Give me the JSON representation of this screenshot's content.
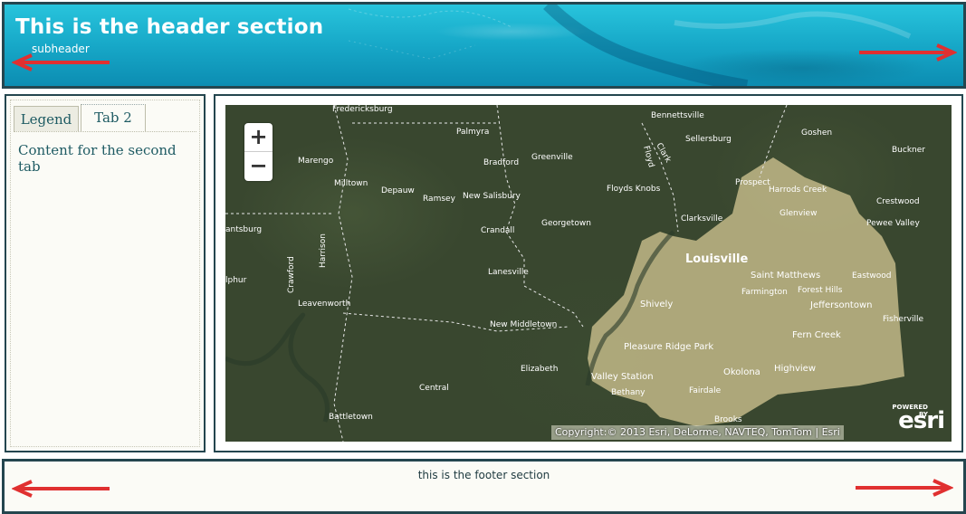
{
  "header": {
    "title": "This is the header section",
    "subtitle": "subheader"
  },
  "tabs": [
    {
      "label": "Legend",
      "active": false
    },
    {
      "label": "Tab 2",
      "active": true
    }
  ],
  "tab_content": "Content for the second tab",
  "map": {
    "zoom_in_label": "+",
    "zoom_out_label": "−",
    "attribution": "Copyright:© 2013 Esri, DeLorme, NAVTEQ, TomTom | Esri",
    "logo_powered": "POWERED BY",
    "logo_word": "esri",
    "places": [
      "Fredericksburg",
      "Palmyra",
      "Bennettsville",
      "Sellersburg",
      "Goshen",
      "Buckner",
      "Marengo",
      "Bradford",
      "Greenville",
      "Clark",
      "Floyd",
      "Prospect",
      "Harrods Creek",
      "Glenview",
      "Crestwood",
      "Pewee Valley",
      "Milltown",
      "Depauw",
      "Ramsey",
      "New Salisbury",
      "Floyds Knobs",
      "Clarksville",
      "Crandall",
      "Georgetown",
      "Louisville",
      "Saint Matthews",
      "Eastwood",
      "Farmington",
      "Forest Hills",
      "Jeffersontown",
      "Fisherville",
      "Crawford",
      "Harrison",
      "Leavenworth",
      "Lanesville",
      "Shively",
      "New Middletown",
      "Fern Creek",
      "Pleasure Ridge Park",
      "Okolona",
      "Highview",
      "Elizabeth",
      "Valley Station",
      "Bethany",
      "Fairdale",
      "Central",
      "Battletown",
      "Brooks",
      "antsburg",
      "lphur"
    ]
  },
  "footer": {
    "text": "this is the footer section"
  },
  "colors": {
    "border": "#24464f",
    "arrow": "#e03030",
    "header_bg": "#17a8c8",
    "text_teal": "#1e5b63"
  }
}
